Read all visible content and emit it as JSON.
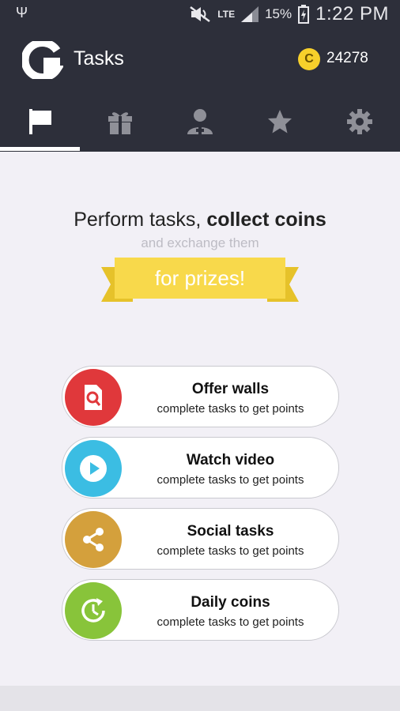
{
  "status_bar": {
    "usb_glyph": "Ψ",
    "network": "LTE",
    "battery_percent": "15%",
    "time": "1:22 PM"
  },
  "app_bar": {
    "title": "Tasks",
    "coin_symbol": "C",
    "coin_balance": "24278"
  },
  "tabs": [
    {
      "icon": "flag-icon",
      "selected": true
    },
    {
      "icon": "gift-icon",
      "selected": false
    },
    {
      "icon": "add-user-icon",
      "selected": false
    },
    {
      "icon": "star-icon",
      "selected": false
    },
    {
      "icon": "gear-icon",
      "selected": false
    }
  ],
  "hero": {
    "headline_plain": "Perform tasks, ",
    "headline_bold": "collect coins",
    "subline": "and exchange them",
    "ribbon_text": "for prizes!"
  },
  "tasks": [
    {
      "title": "Offer walls",
      "subtitle": "complete tasks to get points",
      "icon": "search-document-icon",
      "color": "#e0383b"
    },
    {
      "title": "Watch video",
      "subtitle": "complete tasks to get points",
      "icon": "play-icon",
      "color": "#3bbde3"
    },
    {
      "title": "Social tasks",
      "subtitle": "complete tasks to get points",
      "icon": "share-icon",
      "color": "#d4a03c"
    },
    {
      "title": "Daily coins",
      "subtitle": "complete tasks to get points",
      "icon": "clock-refresh-icon",
      "color": "#88c43a"
    }
  ],
  "colors": {
    "app_bar": "#2d2f3a",
    "background": "#f2f0f6",
    "accent_coin": "#f7d02b",
    "ribbon": "#f8d94b",
    "tab_inactive": "#8f9098",
    "tab_active": "#ffffff"
  }
}
